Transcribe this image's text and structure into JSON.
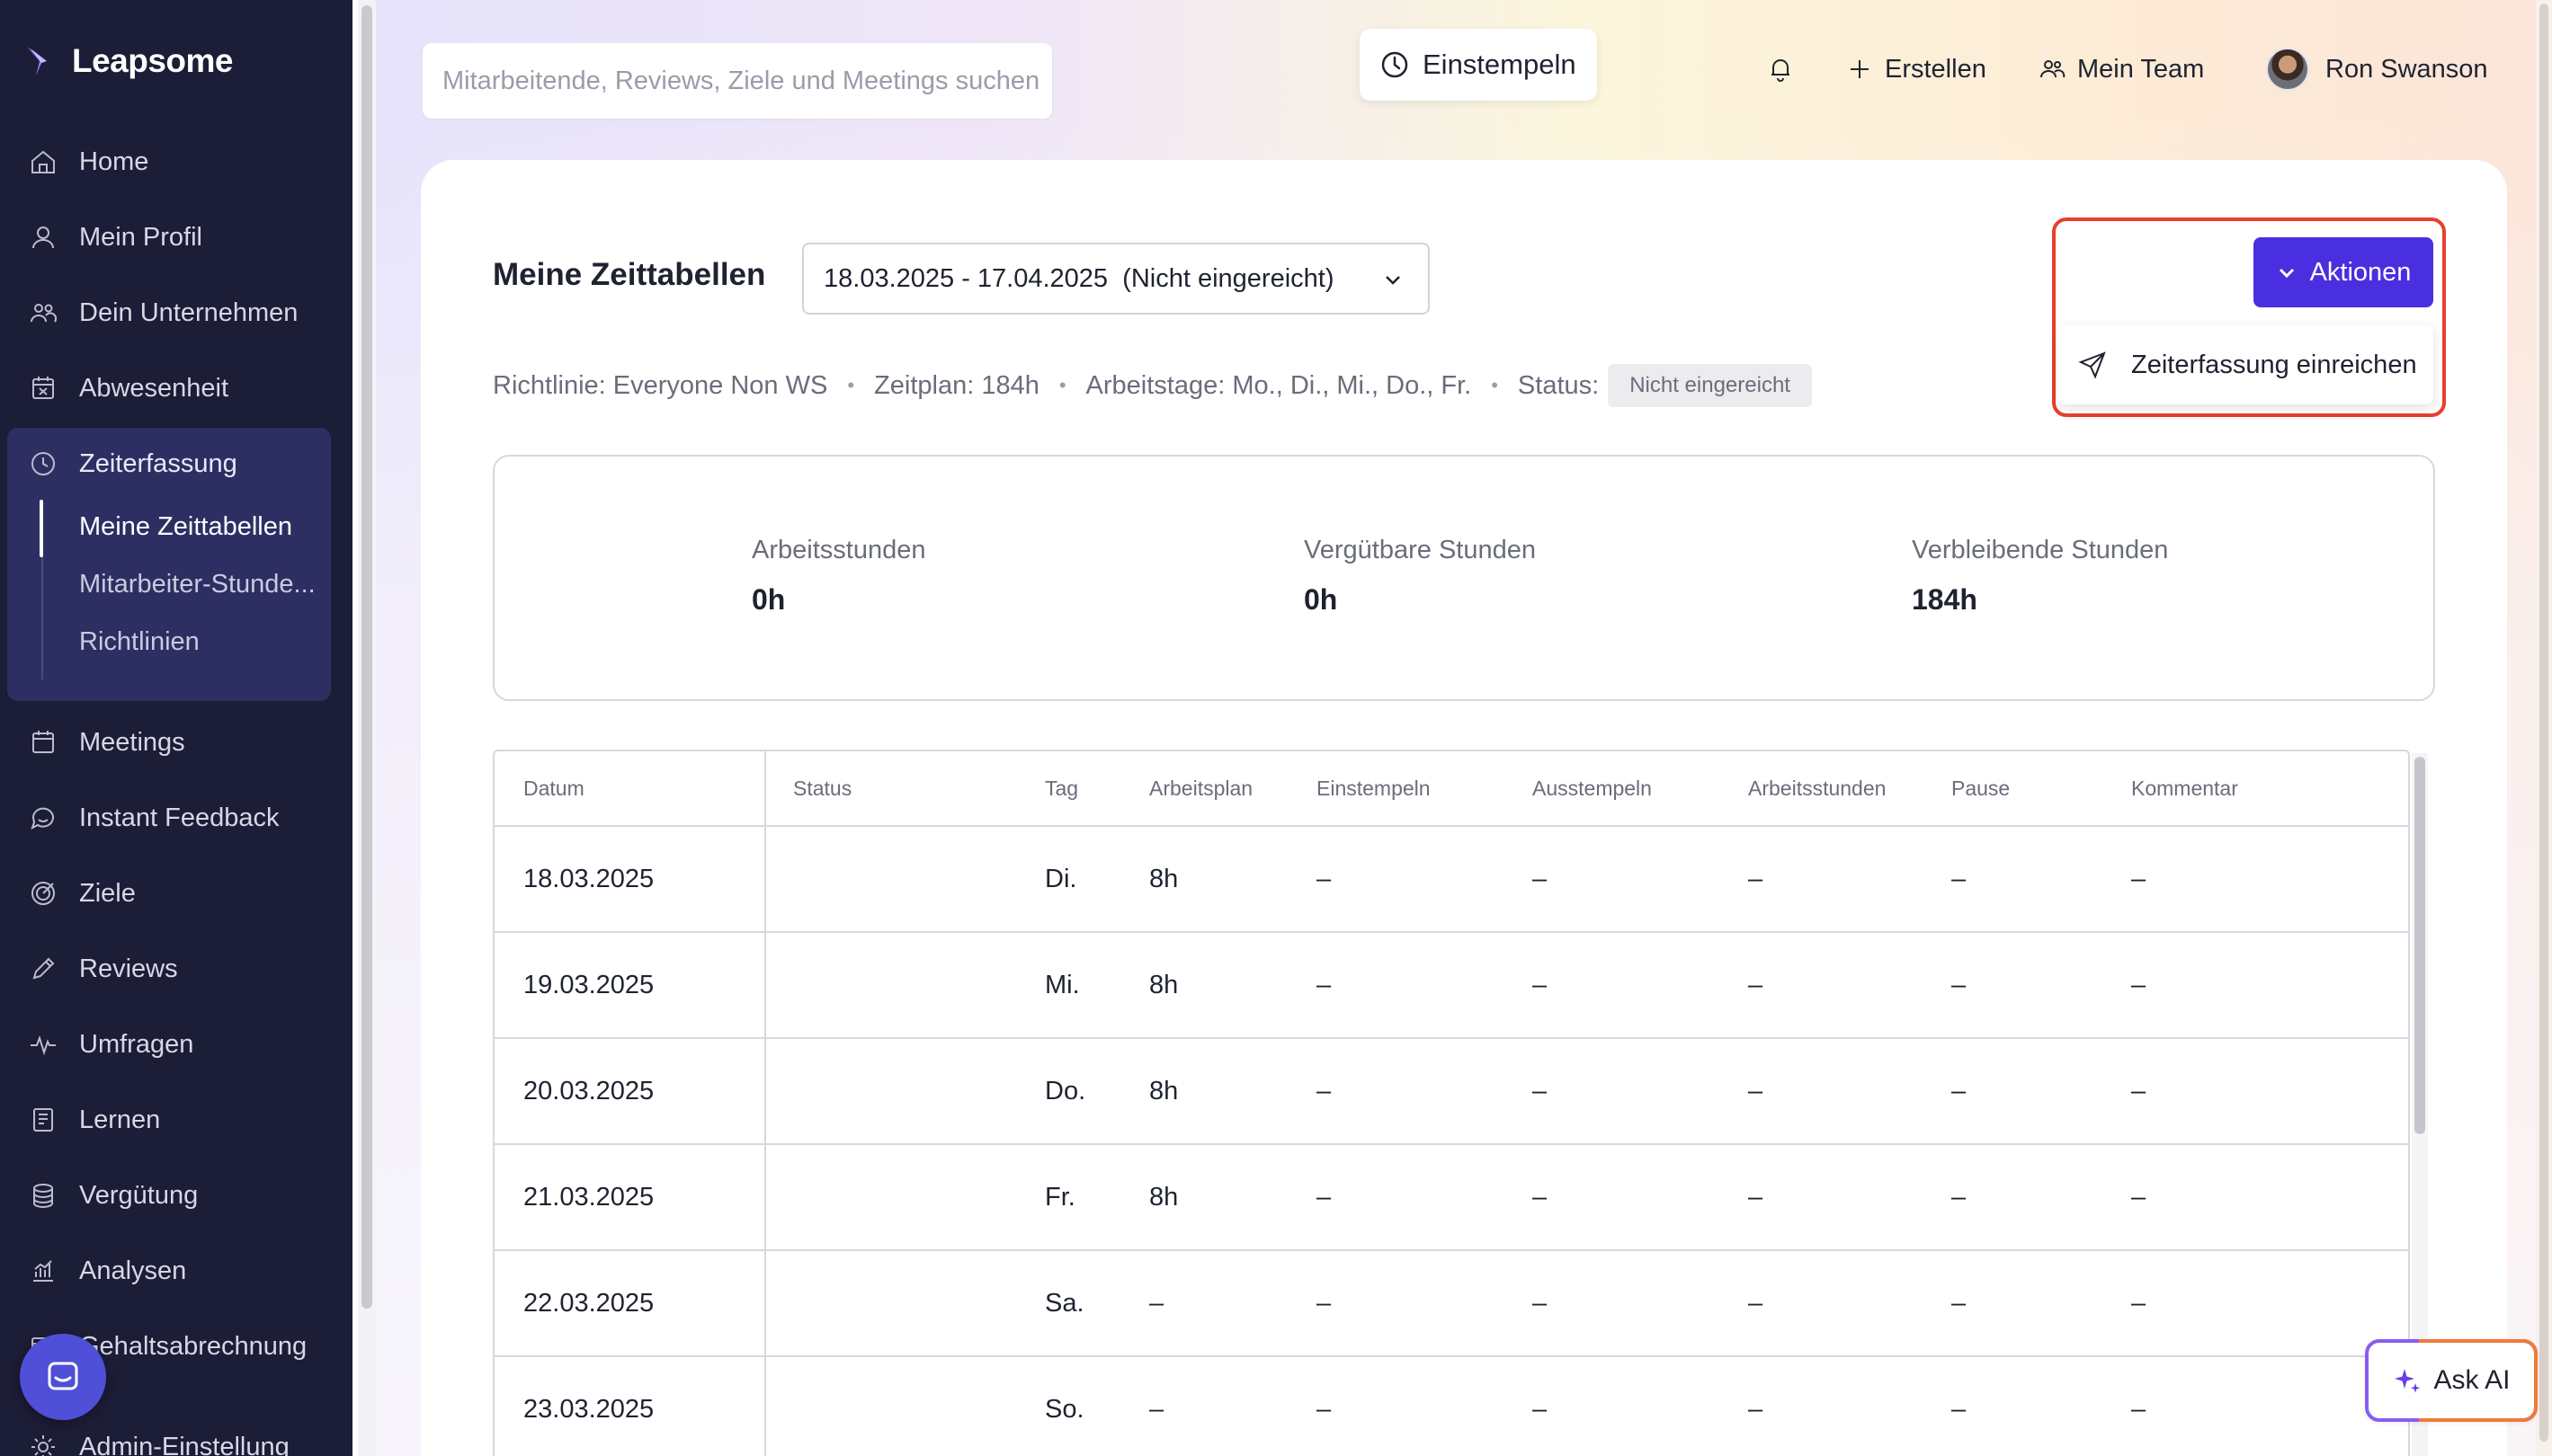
{
  "sidebar": {
    "brand": "Leapsome",
    "items": [
      {
        "label": "Home",
        "icon": "home-icon"
      },
      {
        "label": "Mein Profil",
        "icon": "user-icon"
      },
      {
        "label": "Dein Unternehmen",
        "icon": "team-icon"
      },
      {
        "label": "Abwesenheit",
        "icon": "calendar-x-icon"
      },
      {
        "label": "Zeiterfassung",
        "icon": "clock-icon"
      },
      {
        "label": "Meetings",
        "icon": "calendar-icon"
      },
      {
        "label": "Instant Feedback",
        "icon": "chat-icon"
      },
      {
        "label": "Ziele",
        "icon": "target-icon"
      },
      {
        "label": "Reviews",
        "icon": "pencil-icon"
      },
      {
        "label": "Umfragen",
        "icon": "pulse-icon"
      },
      {
        "label": "Lernen",
        "icon": "book-icon"
      },
      {
        "label": "Vergütung",
        "icon": "coins-icon"
      },
      {
        "label": "Analysen",
        "icon": "chart-icon"
      },
      {
        "label": "Gehaltsabrechnung",
        "icon": "payroll-icon"
      },
      {
        "label": "Admin-Einstellung",
        "icon": "gear-icon"
      }
    ],
    "sub_items": [
      {
        "label": "Meine Zeittabellen",
        "active": true
      },
      {
        "label": "Mitarbeiter-Stunde...",
        "active": false
      },
      {
        "label": "Richtlinien",
        "active": false
      }
    ]
  },
  "topbar": {
    "search_placeholder": "Mitarbeitende, Reviews, Ziele und Meetings suchen",
    "clock_in": "Einstempeln",
    "create": "Erstellen",
    "my_team": "Mein Team",
    "user_name": "Ron Swanson"
  },
  "page": {
    "title": "Meine Zeittabellen",
    "period": "18.03.2025 - 17.04.2025  (Nicht eingereicht)",
    "meta": {
      "policy": "Richtlinie: Everyone Non WS",
      "schedule": "Zeitplan: 184h",
      "workdays": "Arbeitstage: Mo., Di., Mi., Do., Fr.",
      "status_label": "Status:",
      "status_value": "Nicht eingereicht"
    },
    "actions_button": "Aktionen",
    "actions_menu": [
      "Zeiterfassung einreichen"
    ],
    "stats": [
      {
        "label": "Arbeitsstunden",
        "value": "0h"
      },
      {
        "label": "Vergütbare Stunden",
        "value": "0h"
      },
      {
        "label": "Verbleibende Stunden",
        "value": "184h"
      }
    ]
  },
  "table": {
    "headers": [
      "Datum",
      "Status",
      "Tag",
      "Arbeitsplan",
      "Einstempeln",
      "Ausstempeln",
      "Arbeitsstunden",
      "Pause",
      "Kommentar"
    ],
    "rows": [
      [
        "18.03.2025",
        "",
        "Di.",
        "8h",
        "–",
        "–",
        "–",
        "–",
        "–"
      ],
      [
        "19.03.2025",
        "",
        "Mi.",
        "8h",
        "–",
        "–",
        "–",
        "–",
        "–"
      ],
      [
        "20.03.2025",
        "",
        "Do.",
        "8h",
        "–",
        "–",
        "–",
        "–",
        "–"
      ],
      [
        "21.03.2025",
        "",
        "Fr.",
        "8h",
        "–",
        "–",
        "–",
        "–",
        "–"
      ],
      [
        "22.03.2025",
        "",
        "Sa.",
        "–",
        "–",
        "–",
        "–",
        "–",
        "–"
      ],
      [
        "23.03.2025",
        "",
        "So.",
        "–",
        "–",
        "–",
        "–",
        "–",
        "–"
      ]
    ]
  },
  "ask_ai": "Ask AI",
  "colors": {
    "sidebar_bg": "#1c1d36",
    "sidebar_active_bg": "#2d2f63",
    "accent": "#4a2fe0",
    "highlight_border": "#e8402c"
  }
}
